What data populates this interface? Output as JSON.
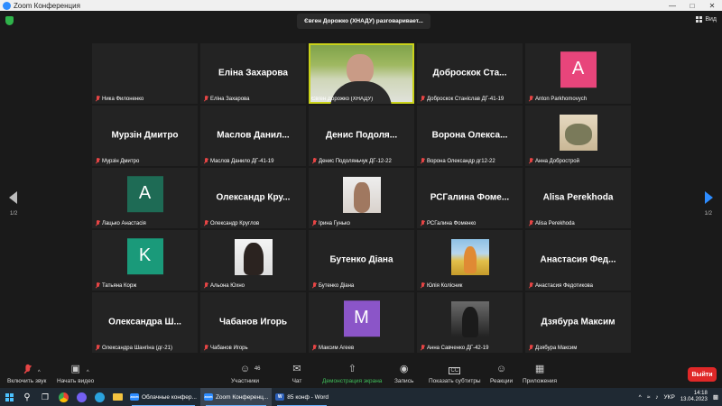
{
  "window": {
    "title": "Zoom Конференция"
  },
  "speaking_banner": "Євген Дорожко (ХНАДУ) разговаривает...",
  "view_label": "Вид",
  "pagination": {
    "left": "1/2",
    "right": "1/2"
  },
  "tiles": [
    {
      "name": "",
      "label": "Ника Филоненко",
      "type": "blank"
    },
    {
      "name": "Еліна Захарова",
      "label": "Еліна Захарова",
      "type": "name"
    },
    {
      "name": "",
      "label": "Євген Дорожко (ХНАДУ)",
      "type": "video",
      "active": true,
      "muted": false
    },
    {
      "name": "Доброскок Ста...",
      "label": "Доброскок Станіслав ДГ-41-19",
      "type": "name"
    },
    {
      "name": "",
      "label": "Anton Parkhomovych",
      "type": "avatar",
      "letter": "A",
      "color": "#e8457b"
    },
    {
      "name": "Мурзін Дмитро",
      "label": "Мурзін Дмитро",
      "type": "name"
    },
    {
      "name": "Маслов Данил...",
      "label": "Маслов Данило ДГ-41-19",
      "type": "name"
    },
    {
      "name": "Денис Подоля...",
      "label": "Денис Подоляньчук ДГ-12-22",
      "type": "name"
    },
    {
      "name": "Ворона Олекса...",
      "label": "Ворона Олександр дг12-22",
      "type": "name"
    },
    {
      "name": "",
      "label": "Анна Добрострой",
      "type": "photo",
      "photo": "cat"
    },
    {
      "name": "",
      "label": "Лацько Анастасія",
      "type": "avatar",
      "letter": "A",
      "color": "#1e6b55"
    },
    {
      "name": "Олександр Кру...",
      "label": "Олександр Круглов",
      "type": "name"
    },
    {
      "name": "",
      "label": "Ірина Гунько",
      "type": "photo",
      "photo": "girl1"
    },
    {
      "name": "РСГалина Фоме...",
      "label": "РСГалина Фоменко",
      "type": "name"
    },
    {
      "name": "Alisa Perekhoda",
      "label": "Alisa Perekhoda",
      "type": "name"
    },
    {
      "name": "",
      "label": "Татьяна Корж",
      "type": "avatar",
      "letter": "K",
      "color": "#1a9a7a"
    },
    {
      "name": "",
      "label": "Альона Юхно",
      "type": "photo",
      "photo": "girl2"
    },
    {
      "name": "Бутенко Діана",
      "label": "Бутенко Діана",
      "type": "name"
    },
    {
      "name": "",
      "label": "Юлія Колісник",
      "type": "photo",
      "photo": "field"
    },
    {
      "name": "Анастасия Фед...",
      "label": "Анастасия Федотикова",
      "type": "name"
    },
    {
      "name": "Олександра Ш...",
      "label": "Олександра Шангіна (дг-21)",
      "type": "name"
    },
    {
      "name": "Чабанов Игорь",
      "label": "Чабанов Игорь",
      "type": "name"
    },
    {
      "name": "",
      "label": "Максим Агеев",
      "type": "avatar",
      "letter": "M",
      "color": "#8b55c8"
    },
    {
      "name": "",
      "label": "Анна Савченко ДГ-42-19",
      "type": "photo",
      "photo": "dark"
    },
    {
      "name": "Дзябура Максим",
      "label": "Дзябура Максим",
      "type": "name"
    }
  ],
  "toolbar": {
    "unmute": "Включить звук",
    "start_video": "Начать видео",
    "participants": "Участники",
    "participants_count": "46",
    "chat": "Чат",
    "share_screen": "Демонстрация экрана",
    "record": "Запись",
    "captions": "Показать субтитры",
    "reactions": "Реакции",
    "apps": "Приложения",
    "leave": "Выйти"
  },
  "taskbar": {
    "apps": [
      {
        "label": "Облачные конфер...",
        "color": "#2d8cff",
        "mini": "zoom"
      },
      {
        "label": "Zoom Конференц...",
        "color": "#2d8cff",
        "mini": "zoom",
        "active": true
      },
      {
        "label": "85 конф - Word",
        "color": "#2b5fb8",
        "mini": "W"
      }
    ],
    "lang": "УКР",
    "time": "14:18",
    "date": "13.04.2023"
  },
  "colors": {
    "accent": "#2d8cff",
    "leave": "#e02828",
    "share": "#3fbf5a",
    "active_speaker": "#c9d21a"
  }
}
